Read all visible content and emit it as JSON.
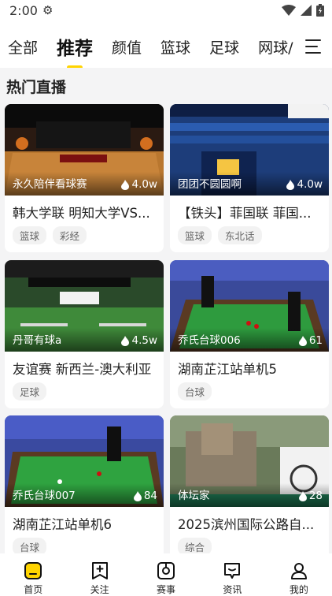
{
  "status_bar": {
    "time": "2:00",
    "icons": [
      "gear-icon",
      "wifi-icon",
      "signal-icon",
      "battery-icon"
    ]
  },
  "tabs": [
    {
      "label": "全部",
      "active": false
    },
    {
      "label": "推荐",
      "active": true
    },
    {
      "label": "颜值",
      "active": false
    },
    {
      "label": "篮球",
      "active": false
    },
    {
      "label": "足球",
      "active": false
    },
    {
      "label": "网球/",
      "active": false
    }
  ],
  "section_title": "热门直播",
  "cards": [
    {
      "streamer": "永久陪伴看球赛",
      "views": "4.0w",
      "title": "韩大学联   明知大学VS...",
      "tags": [
        "篮球",
        "彩经"
      ]
    },
    {
      "streamer": "团团不圆圆啊",
      "views": "4.0w",
      "title": "【铁头】菲国联 菲国...",
      "tags": [
        "篮球",
        "东北话"
      ]
    },
    {
      "streamer": "丹哥有球a",
      "views": "4.5w",
      "title": "友谊赛 新西兰-澳大利亚",
      "tags": [
        "足球"
      ]
    },
    {
      "streamer": "乔氏台球006",
      "views": "61",
      "title": "湖南芷江站单机5",
      "tags": [
        "台球"
      ]
    },
    {
      "streamer": "乔氏台球007",
      "views": "84",
      "title": "湖南芷江站单机6",
      "tags": [
        "台球"
      ]
    },
    {
      "streamer": "体坛家",
      "views": "28",
      "title": "2025滨州国际公路自...",
      "tags": [
        "综合"
      ]
    }
  ],
  "bottom_nav": [
    {
      "label": "首页",
      "icon": "home-icon",
      "active": true
    },
    {
      "label": "关注",
      "icon": "follow-icon",
      "active": false
    },
    {
      "label": "赛事",
      "icon": "schedule-icon",
      "active": false
    },
    {
      "label": "资讯",
      "icon": "news-icon",
      "active": false
    },
    {
      "label": "我的",
      "icon": "profile-icon",
      "active": false
    }
  ],
  "colors": {
    "accent": "#ffd400",
    "background": "#f4f4f5"
  }
}
